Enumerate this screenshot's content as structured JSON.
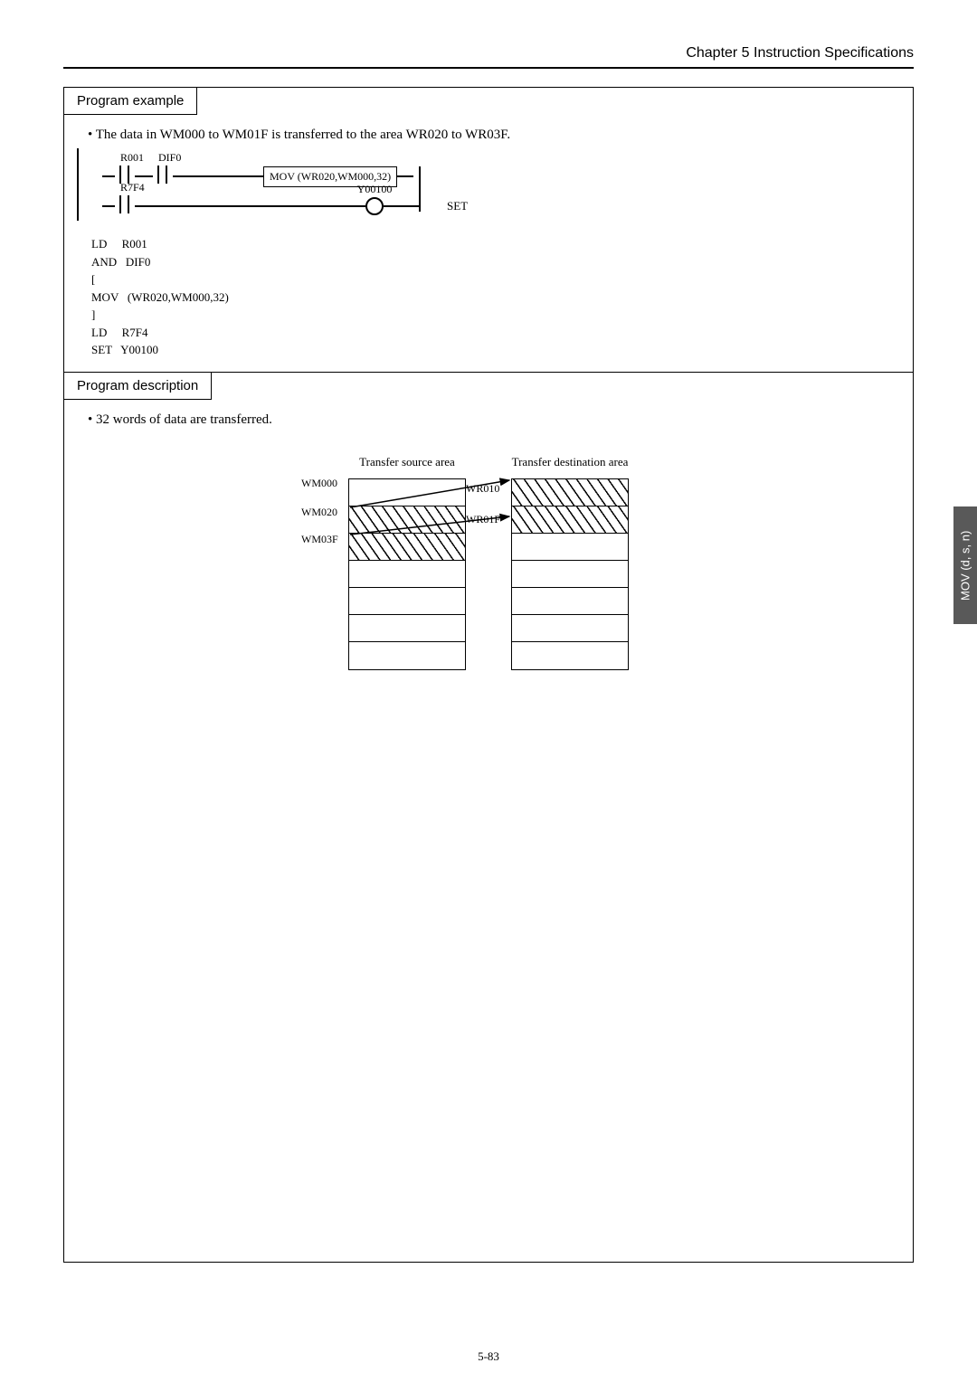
{
  "header": {
    "title": "Chapter 5  Instruction Specifications"
  },
  "example_section": {
    "title": "Program example"
  },
  "example_bullet": "The data in WM000 to WM01F is transferred to the area WR020 to WR03F.",
  "ladder": {
    "contact1": "R001",
    "contact2": "DIF0",
    "instruction_box": "MOV (WR020,WM000,32)",
    "contact3": "R7F4",
    "coil_label": "Y00100",
    "coil_text": "SET"
  },
  "mnemonic": {
    "l1": "LD     R001",
    "l2": "AND   DIF0",
    "l3": "[",
    "l4": "MOV   (WR020,WM000,32)",
    "l5": "]",
    "l6": "LD     R7F4",
    "l7": "SET   Y00100"
  },
  "desc_section": {
    "title": "Program description"
  },
  "desc_bullet": "32 words of data are transferred.",
  "chart_data": {
    "type": "diagram",
    "title_left": "Transfer source area",
    "title_right": "Transfer destination area",
    "source_labels": {
      "top": "WM000",
      "mid": "WM020",
      "bot": "WM03F"
    },
    "dest_labels": {
      "top": "WR010",
      "bot": "WR01F"
    },
    "notes": "Hatched region WM020–WM03F in source maps to WR010–WR01F in destination (32 words)."
  },
  "side_tab": "MOV (d, s, n)",
  "footer": "5-83"
}
